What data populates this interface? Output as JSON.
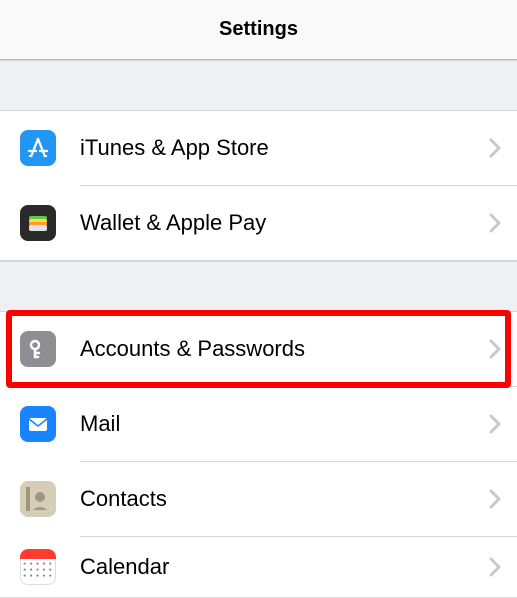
{
  "header": {
    "title": "Settings"
  },
  "group1": {
    "items": [
      {
        "label": "iTunes & App Store"
      },
      {
        "label": "Wallet & Apple Pay"
      }
    ]
  },
  "group2": {
    "items": [
      {
        "label": "Accounts & Passwords"
      },
      {
        "label": "Mail"
      },
      {
        "label": "Contacts"
      },
      {
        "label": "Calendar"
      }
    ]
  },
  "highlighted": "Accounts & Passwords"
}
